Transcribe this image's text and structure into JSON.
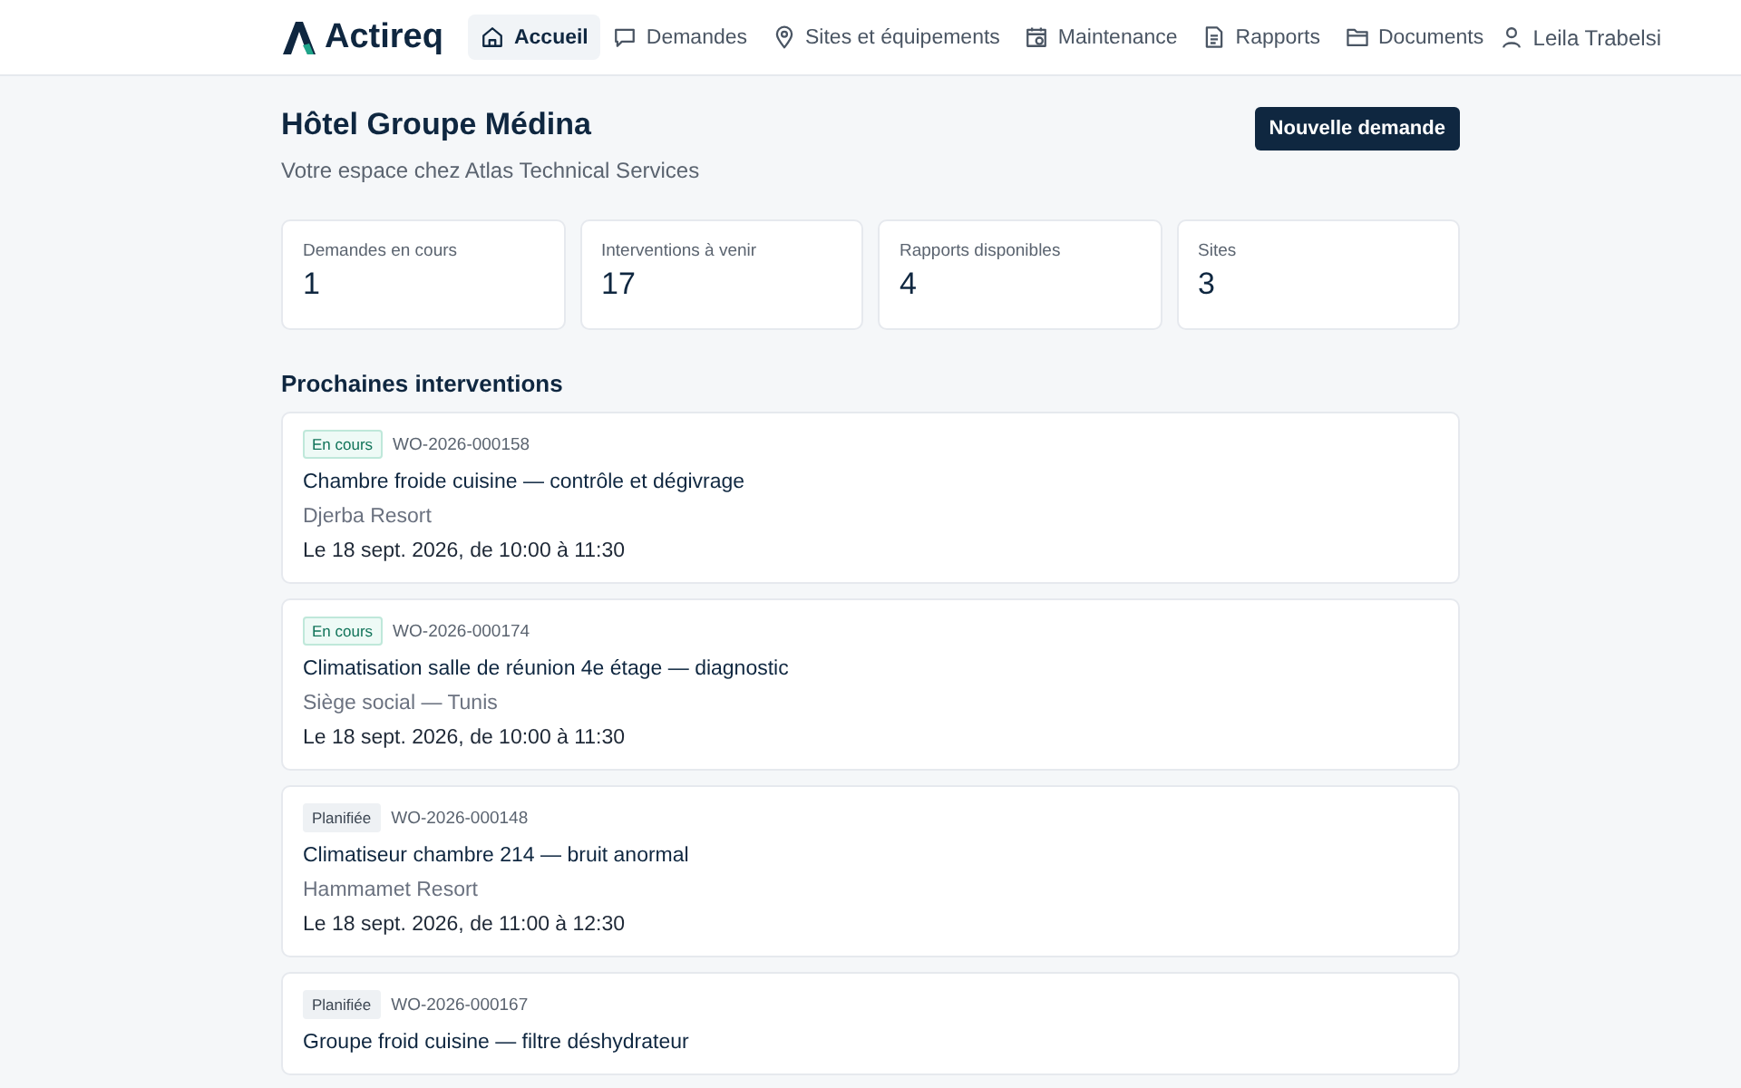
{
  "brand": {
    "name": "Actireq"
  },
  "nav": [
    {
      "label": "Accueil",
      "kind": "home",
      "selected": true
    },
    {
      "label": "Demandes",
      "kind": "requests",
      "selected": false
    },
    {
      "label": "Sites et équipements",
      "kind": "sites",
      "selected": false
    },
    {
      "label": "Maintenance",
      "kind": "maintenance",
      "selected": false
    },
    {
      "label": "Rapports",
      "kind": "reports",
      "selected": false
    },
    {
      "label": "Documents",
      "kind": "documents",
      "selected": false
    }
  ],
  "user": {
    "name": "Leila Trabelsi"
  },
  "header": {
    "title": "Hôtel Groupe Médina",
    "subtitle": "Votre espace chez Atlas Technical Services",
    "action": "Nouvelle demande"
  },
  "stats": [
    {
      "label": "Demandes en cours",
      "value": "1"
    },
    {
      "label": "Interventions à venir",
      "value": "17"
    },
    {
      "label": "Rapports disponibles",
      "value": "4"
    },
    {
      "label": "Sites",
      "value": "3"
    }
  ],
  "section_title": "Prochaines interventions",
  "interventions": [
    {
      "status": {
        "label": "En cours",
        "kind": "in_progress"
      },
      "ref": "WO-2026-000158",
      "title": "Chambre froide cuisine — contrôle et dégivrage",
      "site": "Djerba Resort",
      "when": "Le 18 sept. 2026, de 10:00 à 11:30"
    },
    {
      "status": {
        "label": "En cours",
        "kind": "in_progress"
      },
      "ref": "WO-2026-000174",
      "title": "Climatisation salle de réunion 4e étage — diagnostic",
      "site": "Siège social — Tunis",
      "when": "Le 18 sept. 2026, de 10:00 à 11:30"
    },
    {
      "status": {
        "label": "Planifiée",
        "kind": "planned"
      },
      "ref": "WO-2026-000148",
      "title": "Climatiseur chambre 214 — bruit anormal",
      "site": "Hammamet Resort",
      "when": "Le 18 sept. 2026, de 11:00 à 12:30"
    },
    {
      "status": {
        "label": "Planifiée",
        "kind": "planned"
      },
      "ref": "WO-2026-000167",
      "title": "Groupe froid cuisine — filtre déshydrateur"
    }
  ]
}
